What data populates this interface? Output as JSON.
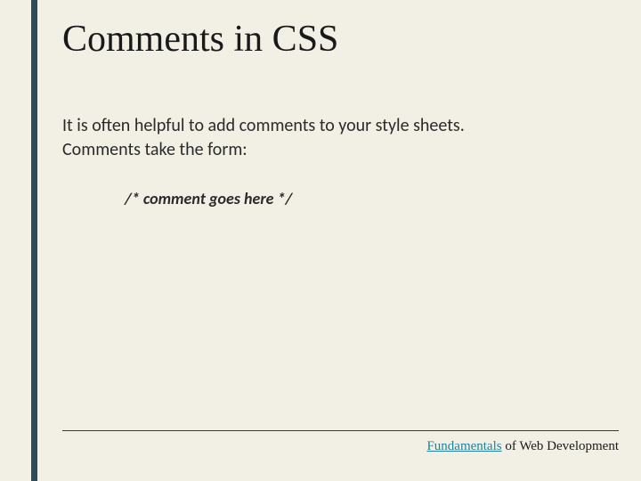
{
  "title": "Comments in CSS",
  "body": "It is often helpful to add comments to your style sheets. Comments take the form:",
  "code_example": "/* comment goes here */",
  "footer": {
    "part1": "Fundamentals",
    "part2": " of Web Development"
  }
}
